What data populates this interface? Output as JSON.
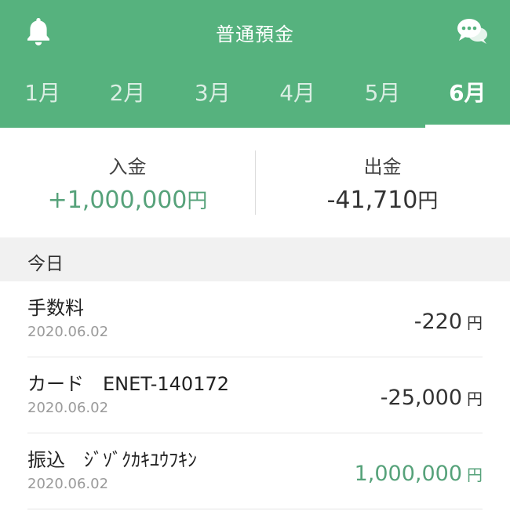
{
  "header": {
    "title": "普通預金",
    "tabs": [
      {
        "label": "1月"
      },
      {
        "label": "2月"
      },
      {
        "label": "3月"
      },
      {
        "label": "4月"
      },
      {
        "label": "5月"
      },
      {
        "label": "6月"
      }
    ],
    "active_tab": "6月",
    "icons": {
      "left": "bell-icon",
      "right": "chat-bubbles-icon"
    },
    "colors": {
      "brand": "#56b27e",
      "positive": "#56a27a"
    }
  },
  "summary": {
    "deposit": {
      "label": "入金",
      "value": "+1,000,000",
      "unit": "円"
    },
    "withdrawal": {
      "label": "出金",
      "value": "-41,710",
      "unit": "円"
    }
  },
  "section": {
    "label": "今日"
  },
  "transactions": [
    {
      "description": "手数料",
      "date": "2020.06.02",
      "amount": "-220",
      "currency": "円"
    },
    {
      "description": "カード　ENET-140172",
      "date": "2020.06.02",
      "amount": "-25,000",
      "currency": "円"
    },
    {
      "description": "振込　ｼﾞｿﾞｸｶｷﾕｳﾌｷﾝ",
      "date": "2020.06.02",
      "amount": "1,000,000",
      "currency": "円"
    }
  ]
}
